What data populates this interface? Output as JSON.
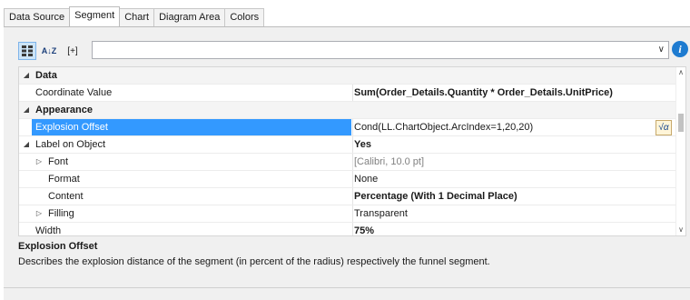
{
  "tabs": [
    {
      "label": "Data Source"
    },
    {
      "label": "Segment"
    },
    {
      "label": "Chart"
    },
    {
      "label": "Diagram Area"
    },
    {
      "label": "Colors"
    }
  ],
  "toolbar": {
    "categorized_icon": "categorized-view-icon",
    "sort_icon": "sort-alpha-icon",
    "sort_label": "A↓Z",
    "expand_label": "[+]",
    "formula_value": "",
    "info_label": "i"
  },
  "grid": {
    "rows": [
      {
        "type": "category",
        "name": "Data"
      },
      {
        "type": "prop",
        "name": "Coordinate Value",
        "value": "Sum(Order_Details.Quantity * Order_Details.UnitPrice)"
      },
      {
        "type": "category",
        "name": "Appearance"
      },
      {
        "type": "prop",
        "name": "Explosion Offset",
        "value": "Cond(LL.ChartObject.ArcIndex=1,20,20)",
        "formula_icon": "√α"
      },
      {
        "type": "group",
        "name": "Label on Object",
        "value": "Yes"
      },
      {
        "type": "sub",
        "name": "Font",
        "value": "[Calibri, 10.0 pt]"
      },
      {
        "type": "sub",
        "name": "Format",
        "value": "None"
      },
      {
        "type": "sub",
        "name": "Content",
        "value": "Percentage (With 1 Decimal Place)"
      },
      {
        "type": "sub",
        "name": "Filling",
        "value": "Transparent"
      },
      {
        "type": "prop",
        "name": "Width",
        "value": "75%"
      }
    ]
  },
  "description": {
    "title": "Explosion Offset",
    "text": "Describes the explosion distance of the segment (in percent of the radius) respectively the funnel segment."
  }
}
